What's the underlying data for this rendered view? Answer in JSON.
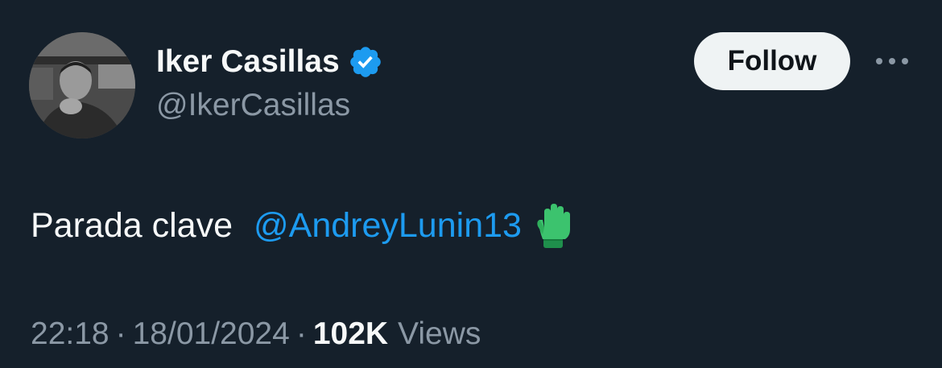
{
  "author": {
    "display_name": "Iker Casillas",
    "handle": "@IkerCasillas",
    "verified": true,
    "avatar_icon": "avatar-photo"
  },
  "actions": {
    "follow_label": "Follow",
    "more_icon": "more-dots-icon"
  },
  "tweet": {
    "text": "Parada clave",
    "mention": "@AndreyLunin13",
    "emoji_icon": "goalkeeper-glove-icon"
  },
  "meta": {
    "time": "22:18",
    "date": "18/01/2024",
    "separator": "·",
    "views_count": "102K",
    "views_label": "Views"
  },
  "colors": {
    "background": "#15202b",
    "text_primary": "#f7f9f9",
    "text_secondary": "#8b98a5",
    "link": "#1d9bf0",
    "verified": "#1d9bf0",
    "follow_bg": "#eff3f4"
  }
}
